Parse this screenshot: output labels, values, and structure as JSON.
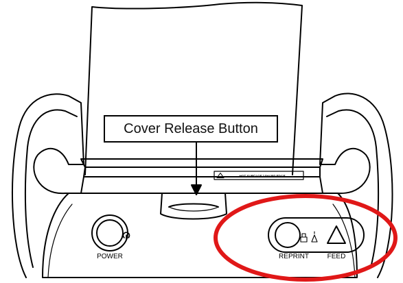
{
  "diagram": {
    "callout_label": "Cover Release Button",
    "warning_label": "HOT SURFACE / SHARP EDGE",
    "button_labels": {
      "power": "POWER",
      "reprint": "REPRINT",
      "feed": "FEED"
    },
    "colors": {
      "line": "#000000",
      "background": "#ffffff",
      "highlight_circle": "#e01818"
    },
    "highlight": "reprint-and-feed-buttons"
  }
}
